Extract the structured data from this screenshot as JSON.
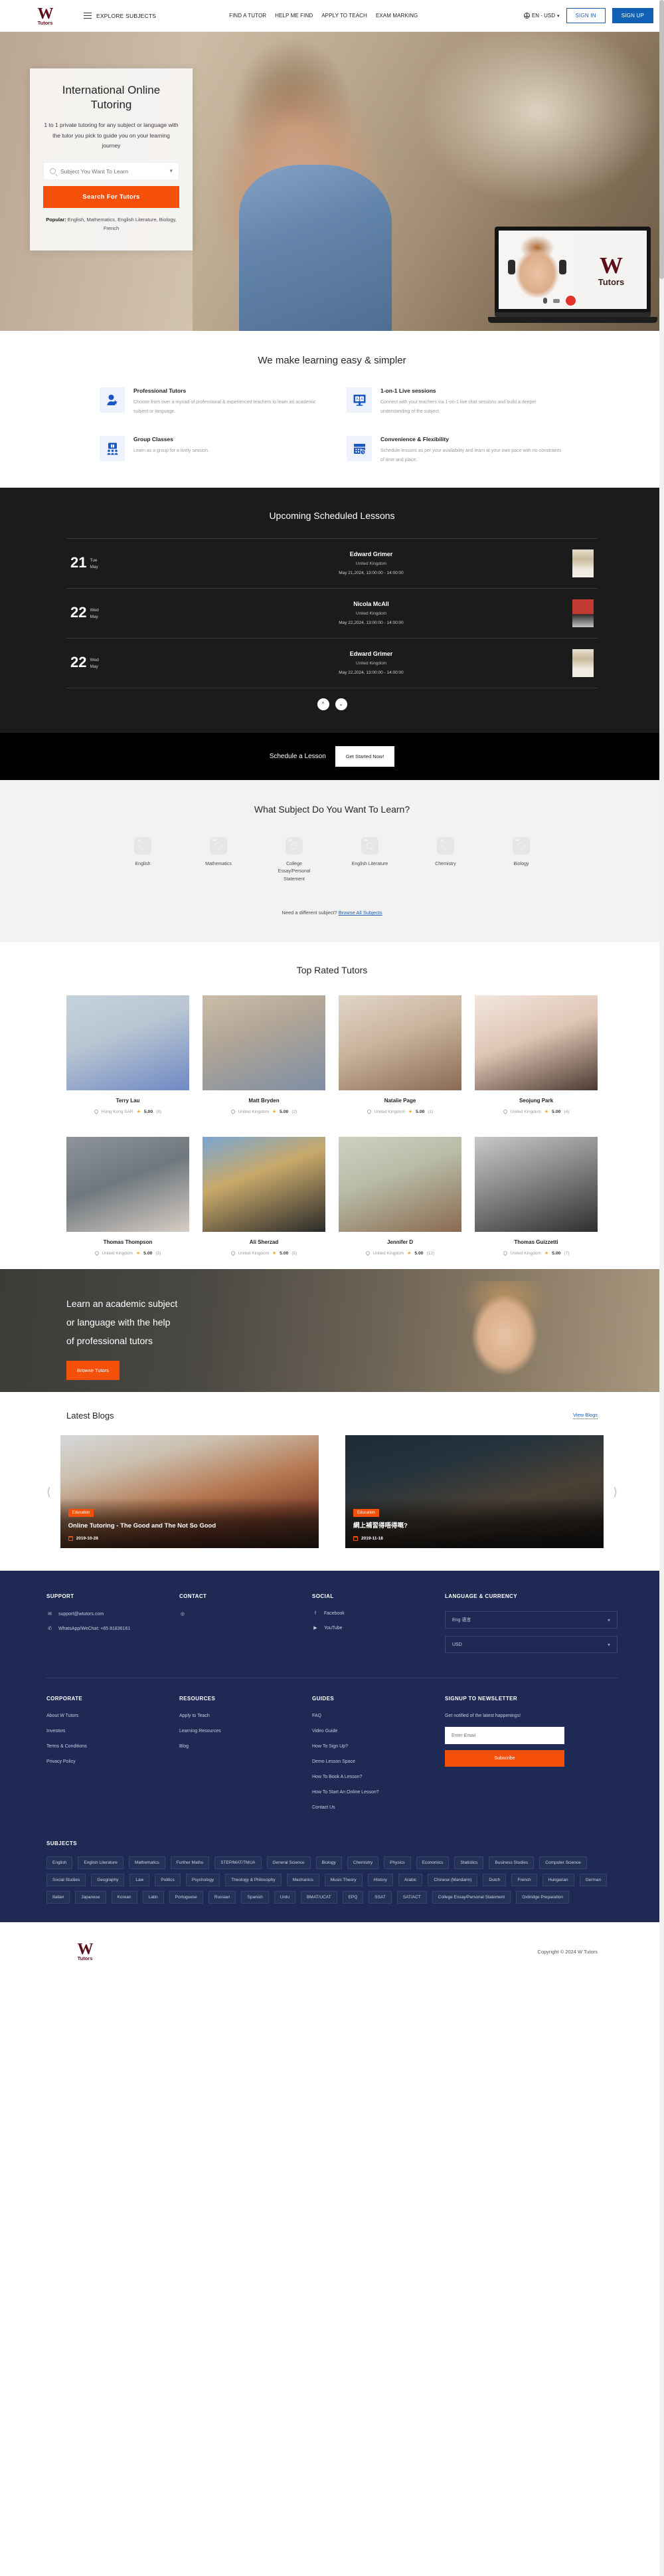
{
  "header": {
    "logo_w": "W",
    "logo_tutors": "Tutors",
    "explore_label": "EXPLORE SUBJECTS",
    "nav": [
      {
        "label": "FIND A TUTOR"
      },
      {
        "label": "HELP ME FIND"
      },
      {
        "label": "APPLY TO TEACH"
      },
      {
        "label": "EXAM MARKING"
      }
    ],
    "locale": "EN - USD",
    "sign_in": "SIGN IN",
    "sign_up": "SIGN UP"
  },
  "hero": {
    "title": "International Online Tutoring",
    "subtitle": "1 to 1 private tutoring for any subject or language with the tutor you pick to guide you on your learning journey",
    "search_placeholder": "Subject You Want To Learn",
    "search_value": "",
    "search_button": "Search For Tutors",
    "popular_label": "Popular:",
    "popular_items": "English,  Mathematics,  English Literature,  Biology,  French",
    "laptop_logo_w": "W",
    "laptop_logo_tutors": "Tutors"
  },
  "features": {
    "title": "We make learning easy & simpler",
    "items": [
      {
        "icon": "person-star-icon",
        "title": "Professional Tutors",
        "desc": "Choose from over a myriad of professional & experienced teachers to learn an academic subject or language."
      },
      {
        "icon": "monitor-chat-icon",
        "title": "1-on-1 Live sessions",
        "desc": "Connect with your teachers via 1-on-1 live chat sessions and build a deeper understanding of the subject."
      },
      {
        "icon": "group-board-icon",
        "title": "Group Classes",
        "desc": "Learn as a group for a lively session."
      },
      {
        "icon": "calendar-clock-icon",
        "title": "Convenience & Flexibility",
        "desc": "Schedule lessons as per your availability and learn at your own pace with no constraints of time and place."
      }
    ]
  },
  "lessons": {
    "title": "Upcoming Scheduled Lessons",
    "rows": [
      {
        "day": "21",
        "dow": "Tue",
        "month": "May",
        "name": "Edward Grimer",
        "country": "United Kingdom",
        "time": "May 21,2024, 13:00:00 - 14:00:00",
        "thumb": "th-a"
      },
      {
        "day": "22",
        "dow": "Wed",
        "month": "May",
        "name": "Nicola McAll",
        "country": "United Kingdom",
        "time": "May 22,2024, 13:00:00 - 14:00:00",
        "thumb": "th-b"
      },
      {
        "day": "22",
        "dow": "Wed",
        "month": "May",
        "name": "Edward Grimer",
        "country": "United Kingdom",
        "time": "May 22,2024, 13:00:00 - 14:00:00",
        "thumb": "th-a"
      }
    ],
    "prev_icon": "chevron-up-icon",
    "next_icon": "chevron-down-icon",
    "schedule_label": "Schedule a Lesson",
    "get_started": "Get Started Now!"
  },
  "subjects_section": {
    "title": "What Subject Do You Want To Learn?",
    "items": [
      {
        "label": "English"
      },
      {
        "label": "Mathematics"
      },
      {
        "label": "College Essay/Personal Statement"
      },
      {
        "label": "English Literature"
      },
      {
        "label": "Chemistry"
      },
      {
        "label": "Biology"
      }
    ],
    "need_text": "Need a different subject?",
    "browse_link": "Browse All Subjects"
  },
  "top_tutors": {
    "title": "Top Rated Tutors",
    "row1": [
      {
        "name": "Terry Lau",
        "location": "Hong Kong SAR",
        "rating": "5.00",
        "count": "(8)",
        "img": "t1"
      },
      {
        "name": "Matt Bryden",
        "location": "United Kingdom",
        "rating": "5.00",
        "count": "(2)",
        "img": "t2"
      },
      {
        "name": "Natalie Page",
        "location": "United Kingdom",
        "rating": "5.00",
        "count": "(1)",
        "img": "t3"
      },
      {
        "name": "Seojung Park",
        "location": "United Kingdom",
        "rating": "5.00",
        "count": "(4)",
        "img": "t4"
      }
    ],
    "row2": [
      {
        "name": "Thomas Thompson",
        "location": "United Kingdom",
        "rating": "5.00",
        "count": "(3)",
        "img": "t5"
      },
      {
        "name": "Ali Sherzad",
        "location": "United Kingdom",
        "rating": "5.00",
        "count": "(5)",
        "img": "t6"
      },
      {
        "name": "Jennifer D",
        "location": "United Kingdom",
        "rating": "5.00",
        "count": "(12)",
        "img": "t7"
      },
      {
        "name": "Thomas Guizzetti",
        "location": "United Kingdom",
        "rating": "5.00",
        "count": "(7)",
        "img": "t8"
      }
    ]
  },
  "cta": {
    "line1": "Learn an academic subject",
    "line2": "or language with the help",
    "line3": "of professional tutors",
    "button": "Browse Tutors"
  },
  "blogs": {
    "title": "Latest Blogs",
    "view_link": "View Blogs",
    "prev_icon": "chevron-left-icon",
    "next_icon": "chevron-right-icon",
    "cards": [
      {
        "badge": "Education",
        "title": "Online Tutoring - The Good and The Not So Good",
        "date": "2019-10-28",
        "img": "b1"
      },
      {
        "badge": "Education",
        "title": "網上補習得唔得嘅?",
        "date": "2019-11-18",
        "img": "b2"
      }
    ]
  },
  "footer": {
    "support": {
      "heading": "SUPPORT",
      "items": [
        {
          "icon": "envelope-icon",
          "glyph": "✉",
          "text": "support@wtutors.com"
        },
        {
          "icon": "phone-icon",
          "glyph": "✆",
          "text": "WhatsApp/WeChat: +65 81836161"
        }
      ]
    },
    "contact": {
      "heading": "CONTACT",
      "items": [
        {
          "icon": "map-pin-icon",
          "glyph": "◎",
          "text": ""
        }
      ]
    },
    "social": {
      "heading": "SOCIAL",
      "items": [
        {
          "icon": "facebook-icon",
          "glyph": "f",
          "text": "Facebook"
        },
        {
          "icon": "youtube-icon",
          "glyph": "▶",
          "text": "YouTube"
        }
      ]
    },
    "langcur": {
      "heading": "LANGUAGE & CURRENCY",
      "language": "Eng 语言",
      "currency": "USD"
    },
    "corporate": {
      "heading": "CORPORATE",
      "links": [
        "About W Tutors",
        "Investors",
        "Terms & Conditions",
        "Privacy Policy"
      ]
    },
    "resources": {
      "heading": "RESOURCES",
      "links": [
        "Apply to Teach",
        "Learning Resources",
        "Blog"
      ]
    },
    "guides": {
      "heading": "GUIDES",
      "links": [
        "FAQ",
        "Video Guide",
        "How To Sign Up?",
        "Demo Lesson Space",
        "How To Book A Lesson?",
        "How To Start An Online Lesson?",
        "Contact Us"
      ]
    },
    "newsletter": {
      "heading": "SIGNUP TO NEWSLETTER",
      "note": "Get notified of the latest happenings!",
      "placeholder": "Enter Email",
      "value": "",
      "button": "Subscribe"
    },
    "subjects": {
      "heading": "SUBJECTS",
      "tags": [
        "English",
        "English Literature",
        "Mathematics",
        "Further Maths",
        "STEP/MAT/TMUA",
        "General Science",
        "Biology",
        "Chemistry",
        "Physics",
        "Economics",
        "Statistics",
        "Business Studies",
        "Computer Science",
        "Social Studies",
        "Geography",
        "Law",
        "Politics",
        "Psychology",
        "Theology & Philosophy",
        "Mechanics",
        "Music Theory",
        "History",
        "Arabic",
        "Chinese (Mandarin)",
        "Dutch",
        "French",
        "Hungarian",
        "German",
        "Italian",
        "Japanese",
        "Korean",
        "Latin",
        "Portuguese",
        "Russian",
        "Spanish",
        "Urdu",
        "BMAT/UCAT",
        "EPQ",
        "SSAT",
        "SAT/ACT",
        "College Essay/Personal Statement",
        "Oxbridge Preparation"
      ]
    },
    "copyright": "Copyright © 2024 W Tutors",
    "logo_w": "W",
    "logo_tutors": "Tutors"
  },
  "colors": {
    "brand_maroon": "#5d0d18",
    "accent_orange": "#f4500a",
    "link_blue": "#1b5fb0",
    "footer_navy": "#1e2a54",
    "dark_section": "#1b1b1b",
    "star_gold": "#f5a623"
  }
}
